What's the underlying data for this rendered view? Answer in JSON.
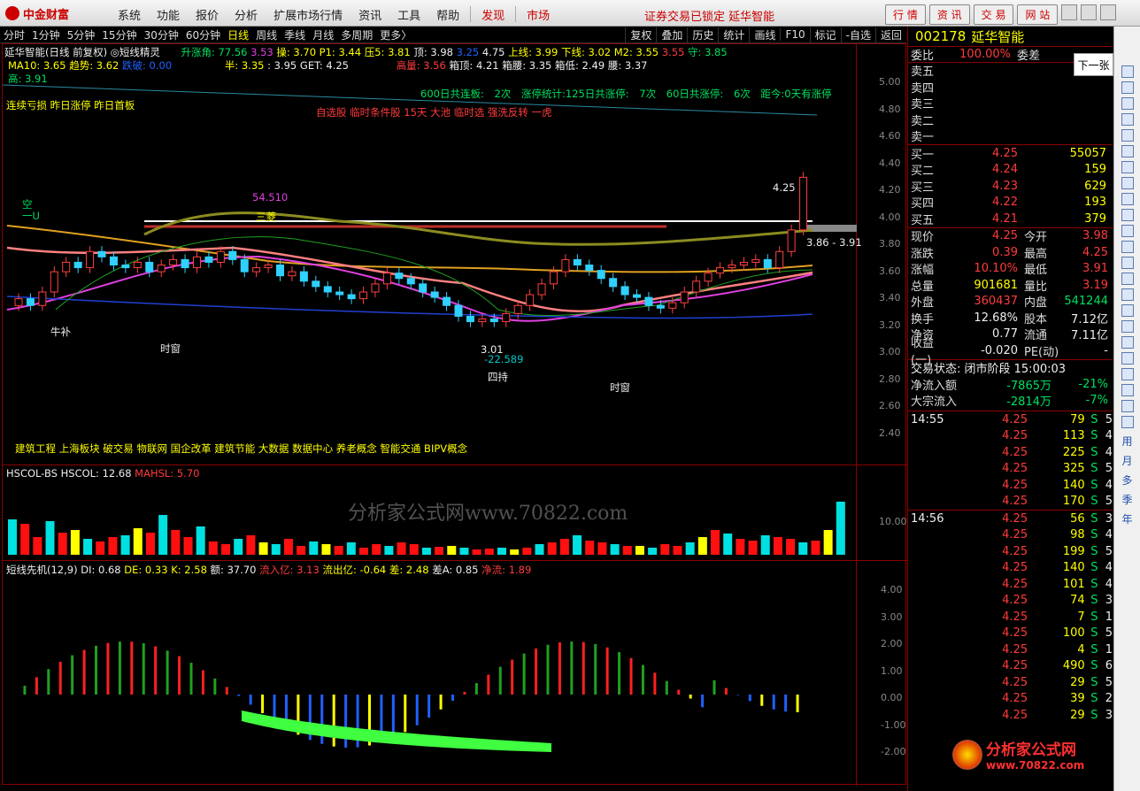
{
  "app": {
    "logo": "中金财富",
    "menu": [
      "系统",
      "功能",
      "报价",
      "分析",
      "扩展市场行情",
      "资讯",
      "工具",
      "帮助"
    ],
    "menu_red": [
      "发现",
      "市场"
    ],
    "status": "证券交易已锁定  延华智能",
    "top_buttons": [
      "行 情",
      "资 讯",
      "交 易",
      "网 站"
    ]
  },
  "periods": [
    "分时",
    "1分钟",
    "5分钟",
    "15分钟",
    "30分钟",
    "60分钟",
    "日线",
    "周线",
    "季线",
    "月线",
    "多周期",
    "更多〉"
  ],
  "tools": [
    "复权",
    "叠加",
    "历史",
    "统计",
    "画线",
    "F10",
    "标记",
    "-自选",
    "返回"
  ],
  "main": {
    "title": "延华智能(日线 前复权)",
    "indicator": "短线精灵",
    "l1": [
      "升涨角: 77.56",
      "3.53",
      "操: 3.70",
      "P1: 3.44",
      "压5: 3.81",
      "顶: 3.98",
      "3.25",
      "4.75",
      "上线: 3.99",
      "下线: 3.02",
      "M2: 3.55",
      "3.55",
      "守: 3.85"
    ],
    "l2": [
      "MA10: 3.65",
      "趋势: 3.62",
      "跌破: 0.00",
      "半: 3.35",
      ": 3.95",
      "GET: 4.25",
      "高量: 3.56",
      "箱顶: 4.21",
      "箱腰: 3.35",
      "箱低: 2.49",
      "腰: 3.37"
    ],
    "l3": "高: 3.91",
    "stats": [
      "600日共连板: 2次",
      "涨停统计:125日共涨停: 7次",
      "60日共涨停: 6次",
      "距今:0天有涨停"
    ],
    "tags": "连续亏损 昨日涨停 昨日首板",
    "pool": "自选股 临时条件股 15天 大池 临时选 强洗反转 一虎",
    "concepts": "建筑工程 上海板块 破交易 物联网 国企改革 建筑节能 大数据 数据中心 养老概念 智能交通 BIPV概念",
    "price_axis": [
      "5.00",
      "4.80",
      "4.60",
      "4.40",
      "4.20",
      "4.00",
      "3.80",
      "3.60",
      "3.40",
      "3.20",
      "3.00",
      "2.80",
      "2.60",
      "2.40"
    ],
    "annotations": {
      "a1": "54.510",
      "a2": "3.01",
      "a3": "-22.589",
      "a4": "4.25",
      "a5": "3.86 - 3.91",
      "a6": "四持",
      "a7": "时窗",
      "a8": "时窗",
      "a9": "空",
      "a10": "一U",
      "a11": "牛补",
      "a12": "三菱"
    }
  },
  "sub1": {
    "title": "HSCOL-BS",
    "v1": "HSCOL: 12.68",
    "v2": "MAHSL: 5.70",
    "axis": "10.00",
    "watermark": "分析家公式网www.70822.com"
  },
  "sub2": {
    "title": "短线先机(12,9)",
    "vals": [
      "DI: 0.68",
      "DE: 0.33",
      "K: 2.58",
      "额: 37.70",
      "流入亿: 3.13",
      "流出亿: -0.64",
      "差: 2.48",
      "差A: 0.85",
      "净流: 1.89"
    ],
    "axis": [
      "4.00",
      "3.00",
      "2.00",
      "1.00",
      "0.00",
      "-1.00",
      "-2.00"
    ]
  },
  "quote": {
    "code": "002178",
    "name": "延华智能",
    "wb_label": "委比",
    "wb": "100.00%",
    "wc_label": "委差",
    "asks": [
      [
        "卖五",
        ""
      ],
      [
        "卖四",
        ""
      ],
      [
        "卖三",
        ""
      ],
      [
        "卖二",
        ""
      ],
      [
        "卖一",
        ""
      ]
    ],
    "bids": [
      [
        "买一",
        "4.25",
        "55057"
      ],
      [
        "买二",
        "4.24",
        "159"
      ],
      [
        "买三",
        "4.23",
        "629"
      ],
      [
        "买四",
        "4.22",
        "193"
      ],
      [
        "买五",
        "4.21",
        "379"
      ]
    ],
    "stats": [
      [
        "现价",
        "4.25",
        "今开",
        "3.98"
      ],
      [
        "涨跌",
        "0.39",
        "最高",
        "4.25"
      ],
      [
        "涨幅",
        "10.10%",
        "最低",
        "3.91"
      ],
      [
        "总量",
        "901681",
        "量比",
        "3.19"
      ],
      [
        "外盘",
        "360437",
        "内盘",
        "541244"
      ],
      [
        "换手",
        "12.68%",
        "股本",
        "7.12亿"
      ],
      [
        "净资",
        "0.77",
        "流通",
        "7.11亿"
      ],
      [
        "收益(一)",
        "-0.020",
        "PE(动)",
        "-"
      ]
    ],
    "status": "交易状态: 闭市阶段 15:00:03",
    "flow": [
      [
        "净流入额",
        "-7865万",
        "-21%"
      ],
      [
        "大宗流入",
        "-2814万",
        "-7%"
      ]
    ],
    "trades1": {
      "time": "14:55",
      "rows": [
        [
          "4.25",
          "79",
          "S",
          "5"
        ],
        [
          "4.25",
          "113",
          "S",
          "4"
        ],
        [
          "4.25",
          "225",
          "S",
          "4"
        ],
        [
          "4.25",
          "325",
          "S",
          "5"
        ],
        [
          "4.25",
          "140",
          "S",
          "4"
        ],
        [
          "4.25",
          "170",
          "S",
          "5"
        ]
      ]
    },
    "trades2": {
      "time": "14:56",
      "rows": [
        [
          "4.25",
          "56",
          "S",
          "3"
        ],
        [
          "4.25",
          "98",
          "S",
          "4"
        ],
        [
          "4.25",
          "199",
          "S",
          "5"
        ],
        [
          "4.25",
          "140",
          "S",
          "4"
        ],
        [
          "4.25",
          "101",
          "S",
          "4"
        ],
        [
          "4.25",
          "74",
          "S",
          "3"
        ],
        [
          "4.25",
          "7",
          "S",
          "1"
        ],
        [
          "4.25",
          "100",
          "S",
          "5"
        ],
        [
          "4.25",
          "4",
          "S",
          "1"
        ],
        [
          "4.25",
          "490",
          "S",
          "6"
        ],
        [
          "4.25",
          "29",
          "S",
          "5"
        ],
        [
          "4.25",
          "39",
          "S",
          "2"
        ],
        [
          "4.25",
          "29",
          "S",
          "3"
        ]
      ]
    },
    "next": "下一张"
  },
  "right_tools": [
    "用",
    "月",
    "多",
    "季",
    "年"
  ],
  "watermark2": {
    "name": "分析家公式网",
    "url": "www.70822.com"
  }
}
